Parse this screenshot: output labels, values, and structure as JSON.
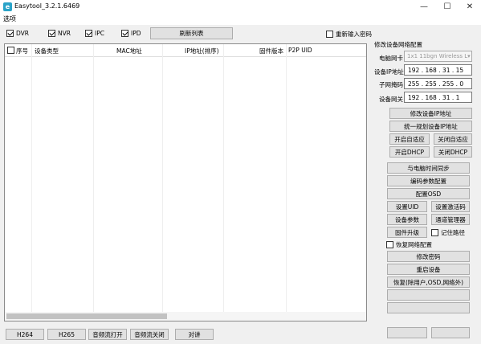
{
  "window": {
    "title": "Easytool_3.2.1.6469",
    "minimize": "—",
    "maximize": "☐",
    "close": "✕"
  },
  "menu": {
    "options": "选项"
  },
  "filters": {
    "dvr": {
      "label": "DVR",
      "checked": true
    },
    "nvr": {
      "label": "NVR",
      "checked": true
    },
    "ipc": {
      "label": "IPC",
      "checked": true
    },
    "ipd": {
      "label": "IPD",
      "checked": true
    },
    "refresh_label": "刷新列表",
    "reenter_password": {
      "label": "重新输入密码",
      "checked": false
    }
  },
  "table": {
    "columns": [
      "序号",
      "设备类型",
      "MAC地址",
      "IP地址(排序)",
      "固件版本",
      "P2P UID"
    ],
    "rows": []
  },
  "network": {
    "group_title": "修改设备网络配置",
    "nic_label": "电脑网卡",
    "nic_value": "1x1 11bgn Wireless L▾",
    "ip_label": "设备IP地址",
    "ip_value": "192 . 168 . 31 . 15",
    "mask_label": "子网掩码",
    "mask_value": "255 . 255 . 255 . 0",
    "gateway_label": "设备网关",
    "gateway_value": "192 . 168 . 31 . 1",
    "modify_ip": "修改设备IP地址",
    "unify_ip": "统一规划设备IP地址",
    "enable_adaptive": "开启自适应",
    "disable_adaptive": "关闭自适应",
    "enable_dhcp": "开启DHCP",
    "disable_dhcp": "关闭DHCP"
  },
  "actions": {
    "sync_time": "与电脑时间同步",
    "encode_params": "编码参数配置",
    "config_osd": "配置OSD",
    "set_uid": "设置UID",
    "set_activation": "设置激活码",
    "device_params": "设备参数",
    "channel_manager": "通道管理器",
    "firmware_upgrade": "固件升级",
    "remember_path": {
      "label": "记住路径",
      "checked": false
    },
    "restore_network": {
      "label": "恢复网络配置",
      "checked": false
    },
    "change_password": "修改密码",
    "reboot": "重启设备",
    "factory_reset": "恢复(除用户,OSD,网络外)"
  },
  "bottom": {
    "h264": "H264",
    "h265": "H265",
    "audio_on": "音频流打开",
    "audio_off": "音频流关闭",
    "intercom": "对讲"
  }
}
